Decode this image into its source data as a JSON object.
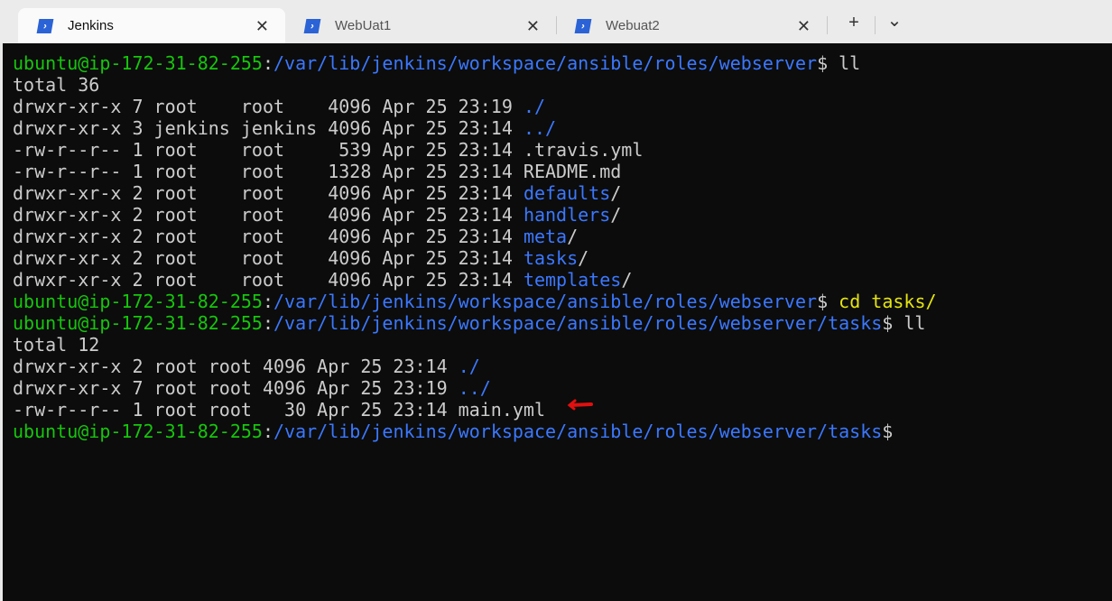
{
  "tabs": [
    {
      "title": "Jenkins",
      "active": true
    },
    {
      "title": "WebUat1",
      "active": false
    },
    {
      "title": "Webuat2",
      "active": false
    }
  ],
  "new_tab_label": "+",
  "dropdown_label": "⌄",
  "colors": {
    "prompt_user": "#16c60c",
    "path": "#3b78ff",
    "command_highlight": "#e5e510",
    "text": "#cccccc",
    "background": "#0c0c0c",
    "annotation_arrow": "#e01010"
  },
  "lines": [
    [
      [
        "g",
        "ubuntu@ip-172-31-82-255"
      ],
      [
        "w",
        ":"
      ],
      [
        "b",
        "/var/lib/jenkins/workspace/ansible/roles/webserver"
      ],
      [
        "w",
        "$ ll"
      ]
    ],
    [
      [
        "w",
        "total 36"
      ]
    ],
    [
      [
        "w",
        "drwxr-xr-x 7 root    root    4096 Apr 25 23:19 "
      ],
      [
        "b",
        "./"
      ]
    ],
    [
      [
        "w",
        "drwxr-xr-x 3 jenkins jenkins 4096 Apr 25 23:14 "
      ],
      [
        "b",
        "../"
      ]
    ],
    [
      [
        "w",
        "-rw-r--r-- 1 root    root     539 Apr 25 23:14 .travis.yml"
      ]
    ],
    [
      [
        "w",
        "-rw-r--r-- 1 root    root    1328 Apr 25 23:14 README.md"
      ]
    ],
    [
      [
        "w",
        "drwxr-xr-x 2 root    root    4096 Apr 25 23:14 "
      ],
      [
        "b",
        "defaults"
      ],
      [
        "w",
        "/"
      ]
    ],
    [
      [
        "w",
        "drwxr-xr-x 2 root    root    4096 Apr 25 23:14 "
      ],
      [
        "b",
        "handlers"
      ],
      [
        "w",
        "/"
      ]
    ],
    [
      [
        "w",
        "drwxr-xr-x 2 root    root    4096 Apr 25 23:14 "
      ],
      [
        "b",
        "meta"
      ],
      [
        "w",
        "/"
      ]
    ],
    [
      [
        "w",
        "drwxr-xr-x 2 root    root    4096 Apr 25 23:14 "
      ],
      [
        "b",
        "tasks"
      ],
      [
        "w",
        "/"
      ]
    ],
    [
      [
        "w",
        "drwxr-xr-x 2 root    root    4096 Apr 25 23:14 "
      ],
      [
        "b",
        "templates"
      ],
      [
        "w",
        "/"
      ]
    ],
    [
      [
        "g",
        "ubuntu@ip-172-31-82-255"
      ],
      [
        "w",
        ":"
      ],
      [
        "b",
        "/var/lib/jenkins/workspace/ansible/roles/webserver"
      ],
      [
        "w",
        "$ "
      ],
      [
        "y",
        "cd tasks/"
      ]
    ],
    [
      [
        "g",
        "ubuntu@ip-172-31-82-255"
      ],
      [
        "w",
        ":"
      ],
      [
        "b",
        "/var/lib/jenkins/workspace/ansible/roles/webserver/tasks"
      ],
      [
        "w",
        "$ ll"
      ]
    ],
    [
      [
        "w",
        "total 12"
      ]
    ],
    [
      [
        "w",
        "drwxr-xr-x 2 root root 4096 Apr 25 23:14 "
      ],
      [
        "b",
        "./"
      ]
    ],
    [
      [
        "w",
        "drwxr-xr-x 7 root root 4096 Apr 25 23:19 "
      ],
      [
        "b",
        "../"
      ]
    ],
    [
      [
        "w",
        "-rw-r--r-- 1 root root   30 Apr 25 23:14 main.yml"
      ]
    ],
    [
      [
        "g",
        "ubuntu@ip-172-31-82-255"
      ],
      [
        "w",
        ":"
      ],
      [
        "b",
        "/var/lib/jenkins/workspace/ansible/roles/webserver/tasks"
      ],
      [
        "w",
        "$"
      ]
    ]
  ]
}
